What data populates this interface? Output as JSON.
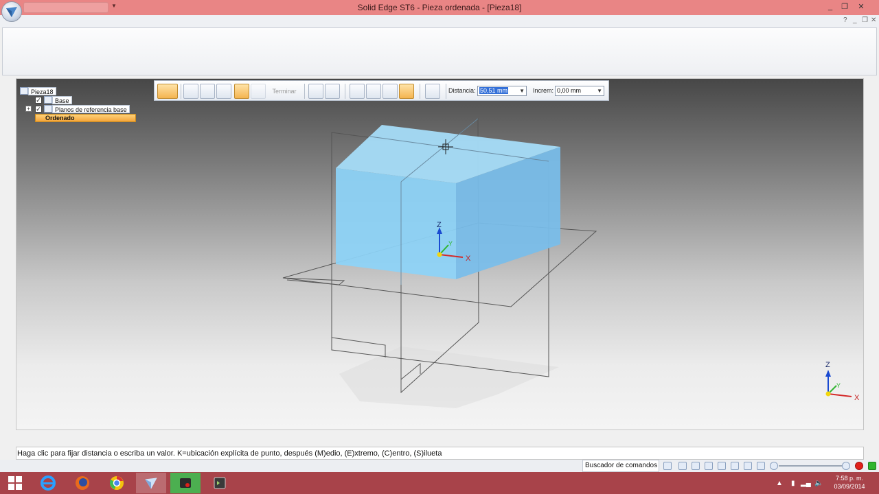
{
  "window": {
    "title": "Solid Edge ST6 - Pieza ordenada - [Pieza18]",
    "controls": [
      "minimize",
      "restore",
      "close"
    ]
  },
  "pathfinder": {
    "root": "Pieza18",
    "items": [
      {
        "label": "Base",
        "checked": true,
        "expandable": false
      },
      {
        "label": "Planos de referencia base",
        "checked": true,
        "expandable": true
      }
    ],
    "section": "Ordenado"
  },
  "command_bar": {
    "finish_label": "Terminar",
    "distance_label": "Distancia:",
    "distance_value": "50,51 mm",
    "increment_label": "Increm:",
    "increment_value": "0,00 mm"
  },
  "triad": {
    "x": "X",
    "y": "Y",
    "z": "Z"
  },
  "prompt": "Haga clic para fijar distancia o escriba un valor. K=ubicación explícita de punto, después (M)edio, (E)xtremo, (C)entro, (S)ilueta",
  "statusbar": {
    "command_finder": "Buscador de comandos"
  },
  "taskbar": {
    "time": "7:58 p. m.",
    "date": "03/09/2014"
  },
  "colors": {
    "title_bar": "#e98585",
    "taskbar": "#a8434a",
    "solid_body": "#8fd0f5",
    "active_section": "#f4a53a"
  }
}
